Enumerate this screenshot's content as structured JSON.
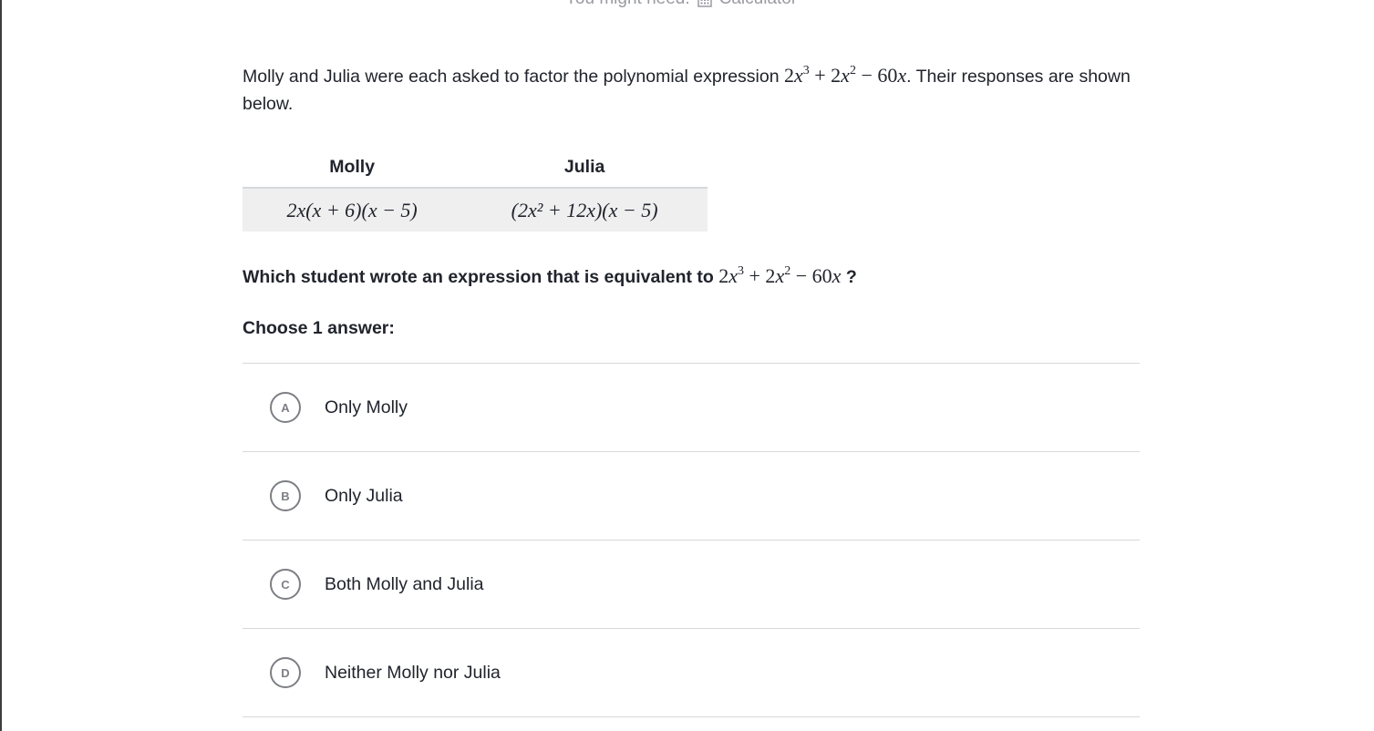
{
  "tools": {
    "prefix": "You might need:",
    "calculator_label": "Calculator",
    "calculator_icon": "calculator-icon"
  },
  "problem": {
    "prompt_before": "Molly and Julia were each asked to factor the polynomial expression",
    "prompt_after": ". Their responses are shown below.",
    "table": {
      "headers": [
        "Molly",
        "Julia"
      ],
      "responses": [
        "2x(x + 6)(x − 5)",
        "(2x² + 12x)(x − 5)"
      ]
    },
    "question_before": "Which student wrote an expression that is equivalent to",
    "question_after": "?",
    "choose_label": "Choose 1 answer:",
    "choices": [
      {
        "letter": "A",
        "label": "Only Molly"
      },
      {
        "letter": "B",
        "label": "Only Julia"
      },
      {
        "letter": "C",
        "label": "Both Molly and Julia"
      },
      {
        "letter": "D",
        "label": "Neither Molly nor Julia"
      }
    ]
  }
}
